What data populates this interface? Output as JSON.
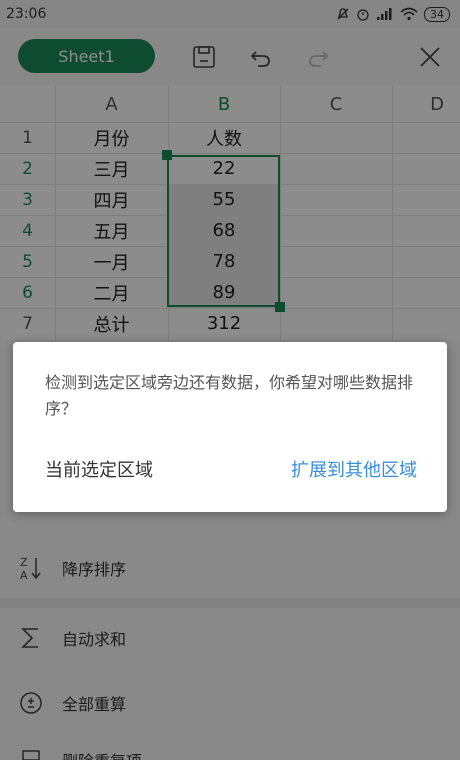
{
  "status_bar": {
    "time": "23:06",
    "battery": "34"
  },
  "toolbar": {
    "sheet_tab": "Sheet1"
  },
  "grid": {
    "columns": [
      "A",
      "B",
      "C",
      "D"
    ],
    "rows": [
      "1",
      "2",
      "3",
      "4",
      "5",
      "6",
      "7"
    ],
    "cells": [
      [
        "月份",
        "人数"
      ],
      [
        "三月",
        "22"
      ],
      [
        "四月",
        "55"
      ],
      [
        "五月",
        "68"
      ],
      [
        "一月",
        "78"
      ],
      [
        "二月",
        "89"
      ],
      [
        "总计",
        "312"
      ]
    ]
  },
  "menu": {
    "items": [
      {
        "label": "降序排序",
        "icon": "sort-desc-icon"
      },
      {
        "label": "自动求和",
        "icon": "sigma-icon"
      },
      {
        "label": "全部重算",
        "icon": "recalc-icon"
      },
      {
        "label": "删除重复项",
        "icon": "remove-duplicates-icon"
      }
    ]
  },
  "dialog": {
    "message": "检测到选定区域旁边还有数据，你希望对哪些数据排序？",
    "left_button": "当前选定区域",
    "right_button": "扩展到其他区域"
  },
  "colors": {
    "accent": "#1a8a5a",
    "link": "#3a8dd8"
  }
}
